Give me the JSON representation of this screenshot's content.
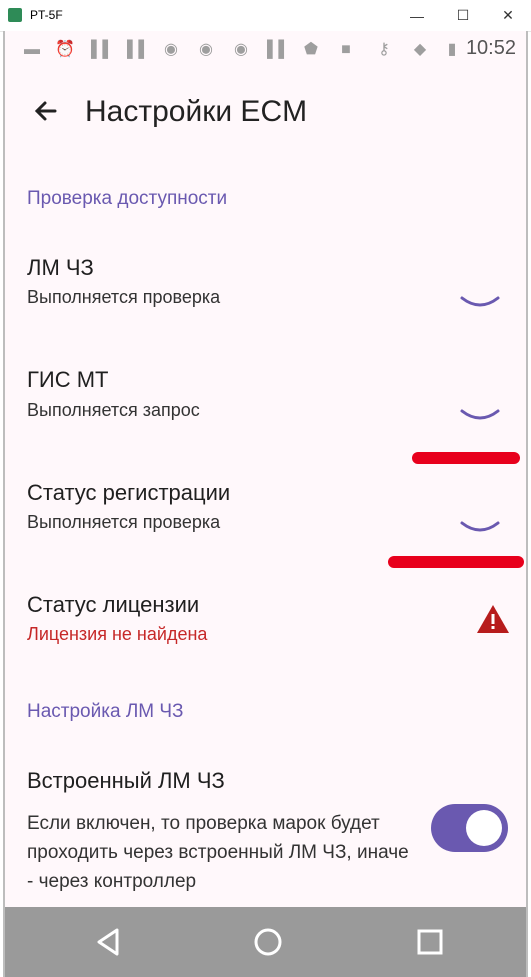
{
  "window": {
    "title": "PT-5F",
    "controls": [
      "minimize",
      "maximize",
      "close"
    ]
  },
  "status_bar": {
    "time": "10:52",
    "icons": [
      "message-icon",
      "alarm-icon",
      "signal-bars-icon",
      "signal-bars-icon",
      "chrome-icon",
      "chrome-icon",
      "chrome-icon",
      "signal-bars-icon",
      "shield-icon",
      "chat-icon",
      "key-icon",
      "wifi-icon",
      "battery-icon"
    ]
  },
  "app_bar": {
    "title": "Настройки ECM",
    "back_icon": "back-arrow-icon"
  },
  "sections": [
    {
      "header": "Проверка доступности",
      "items": [
        {
          "title": "ЛМ ЧЗ",
          "subtitle": "Выполняется проверка",
          "state": "loading"
        },
        {
          "title": "ГИС МТ",
          "subtitle": "Выполняется запрос",
          "state": "loading"
        },
        {
          "title": "Статус регистрации",
          "subtitle": "Выполняется проверка",
          "state": "loading"
        },
        {
          "title": "Статус лицензии",
          "subtitle": "Лицензия не найдена",
          "state": "error"
        }
      ]
    },
    {
      "header": "Настройка ЛМ ЧЗ",
      "items": [
        {
          "title": "Встроенный ЛМ ЧЗ",
          "description": "Если включен, то проверка марок будет проходить через встроенный ЛМ ЧЗ, иначе - через контроллер",
          "toggle_on": true
        }
      ]
    }
  ],
  "colors": {
    "accent": "#6a59b0",
    "error": "#c62828",
    "background": "#fff8fb"
  },
  "nav_bar": {
    "buttons": [
      "back-triangle-icon",
      "home-circle-icon",
      "recents-square-icon"
    ]
  }
}
